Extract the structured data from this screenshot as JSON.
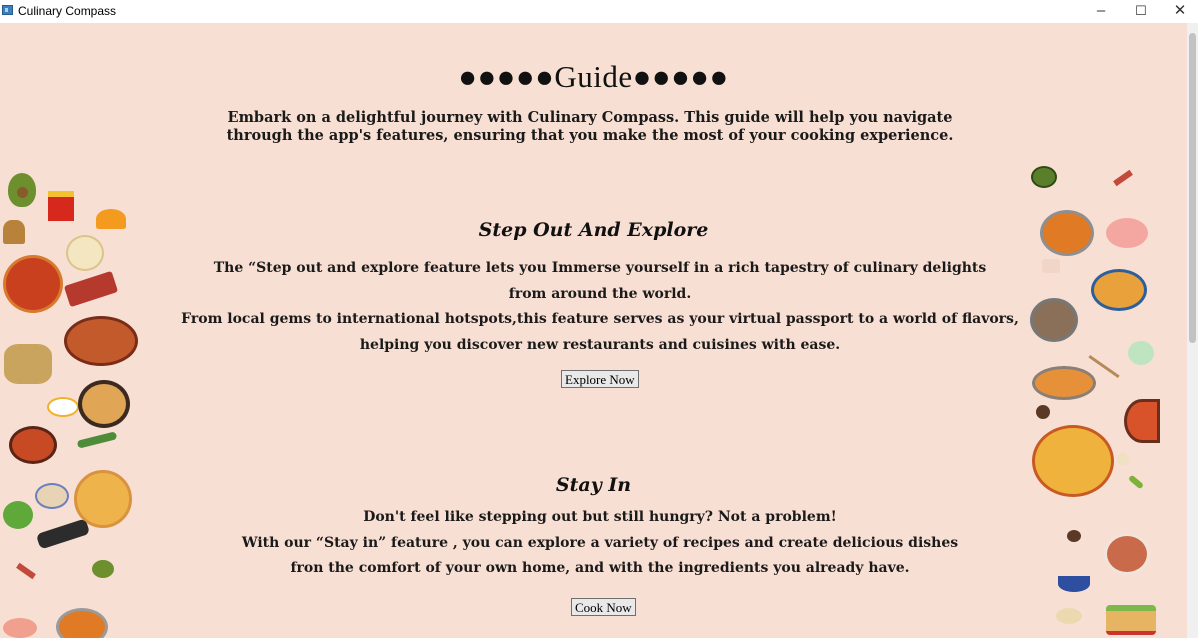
{
  "window": {
    "title": "Culinary Compass",
    "minimize": "–",
    "maximize": "☐",
    "close": "✕"
  },
  "header": {
    "title": "●●●●●Guide●●●●●",
    "intro_line1": "Embark on a delightful journey with Culinary Compass. This guide will help you navigate",
    "intro_line2": "through the app's features, ensuring that you make the most of your cooking experience."
  },
  "explore": {
    "title": "Step  Out And Explore",
    "lines": [
      "The “Step out and explore feature lets you Immerse yourself in a rich tapestry of culinary delights",
      "from around the world.",
      "From local gems to international hotspots,this feature serves as your virtual passport to a world of flavors,",
      "helping you discover new restaurants and cuisines with ease."
    ],
    "button": "Explore Now"
  },
  "stayin": {
    "title": "Stay In",
    "lines": [
      "Don't feel like stepping out but still hungry? Not a problem!",
      "With our “Stay in” feature , you can explore a variety of recipes and create delicious dishes",
      "fron the comfort of your own home, and with the ingredients you already have."
    ],
    "button": "Cook Now"
  },
  "decorations": {
    "left": [
      "avocado-icon",
      "fries-icon",
      "orange-slice-icon",
      "muffin-icon",
      "noodle-bowl-icon",
      "pizza-icon",
      "sushi-plate-icon",
      "ramen-bowl-icon",
      "rice-bowl-icon",
      "egg-icon",
      "scallion-icon",
      "pizza-slice-icon",
      "lettuce-icon",
      "sushi-roll-icon",
      "bacon-icon",
      "avocado-half-icon",
      "curry-pot-icon"
    ],
    "right": [
      "avocado-icon",
      "bacon-icon",
      "curry-pot-icon",
      "shrimp-icon",
      "pasta-bowl-icon",
      "cake-icon",
      "stew-bowl-icon",
      "pizza-icon",
      "paella-pan-icon",
      "tomato-soup-icon",
      "cookie-icon",
      "spice-icon",
      "soup-bowl-icon",
      "steak-plate-icon",
      "sandwich-icon",
      "dumpling-icon"
    ]
  }
}
